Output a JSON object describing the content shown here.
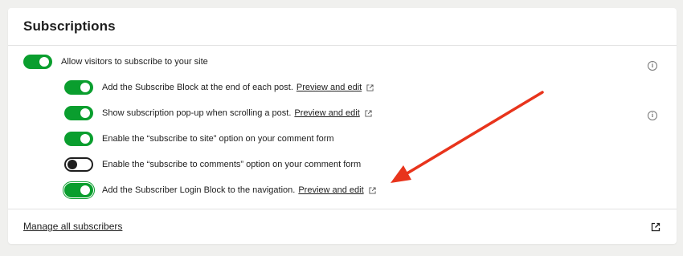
{
  "card": {
    "title": "Subscriptions"
  },
  "settings": {
    "main": {
      "label": "Allow visitors to subscribe to your site",
      "enabled": true
    },
    "items": [
      {
        "label": "Add the Subscribe Block at the end of each post.",
        "link": "Preview and edit",
        "enabled": true
      },
      {
        "label": "Show subscription pop-up when scrolling a post.",
        "link": "Preview and edit",
        "enabled": true
      },
      {
        "label": "Enable the “subscribe to site” option on your comment form",
        "enabled": true
      },
      {
        "label": "Enable the “subscribe to comments” option on your comment form",
        "enabled": false
      },
      {
        "label": "Add the Subscriber Login Block to the navigation.",
        "link": "Preview and edit",
        "enabled": true
      }
    ]
  },
  "footer": {
    "manage_link": "Manage all subscribers"
  },
  "icons": {
    "info": "info-icon",
    "external": "external-link-icon",
    "annotation": "red-arrow-annotation"
  },
  "colors": {
    "toggle_on": "#0a9e2e",
    "annotation_arrow": "#e8341c"
  }
}
